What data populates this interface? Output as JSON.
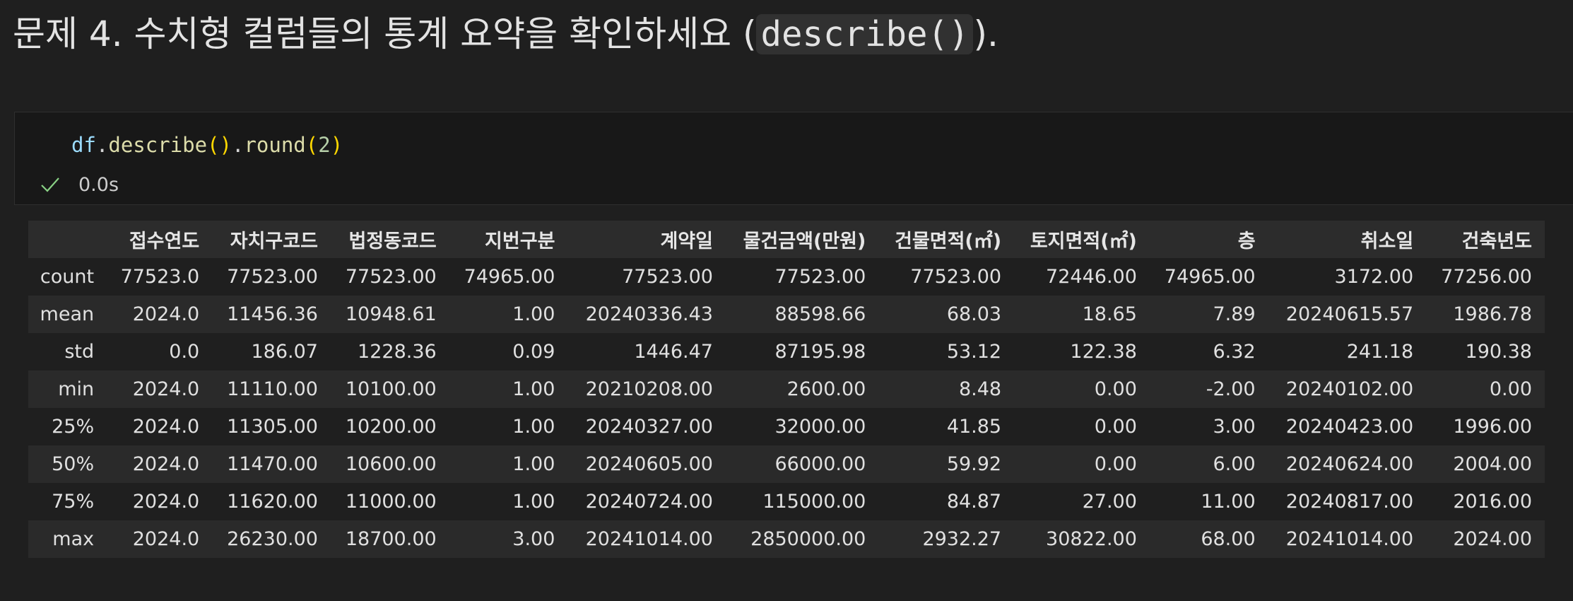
{
  "heading": {
    "prefix": "문제 4. 수치형 컬럼들의 통계 요약을 확인하세요 (",
    "code": "describe()",
    "suffix": ")."
  },
  "cell": {
    "code_tokens": {
      "var": "df",
      "dot1": ".",
      "fn1": "describe",
      "paren1": "()",
      "dot2": ".",
      "fn2": "round",
      "open": "(",
      "arg": "2",
      "close": ")"
    },
    "status_icon": "check-icon",
    "exec_time": "0.0s"
  },
  "table": {
    "columns": [
      "",
      "접수연도",
      "자치구코드",
      "법정동코드",
      "지번구분",
      "계약일",
      "물건금액(만원)",
      "건물면적(㎡)",
      "토지면적(㎡)",
      "층",
      "취소일",
      "건축년도"
    ],
    "rows": [
      {
        "label": "count",
        "values": [
          "77523.0",
          "77523.00",
          "77523.00",
          "74965.00",
          "77523.00",
          "77523.00",
          "77523.00",
          "72446.00",
          "74965.00",
          "3172.00",
          "77256.00"
        ]
      },
      {
        "label": "mean",
        "values": [
          "2024.0",
          "11456.36",
          "10948.61",
          "1.00",
          "20240336.43",
          "88598.66",
          "68.03",
          "18.65",
          "7.89",
          "20240615.57",
          "1986.78"
        ]
      },
      {
        "label": "std",
        "values": [
          "0.0",
          "186.07",
          "1228.36",
          "0.09",
          "1446.47",
          "87195.98",
          "53.12",
          "122.38",
          "6.32",
          "241.18",
          "190.38"
        ]
      },
      {
        "label": "min",
        "values": [
          "2024.0",
          "11110.00",
          "10100.00",
          "1.00",
          "20210208.00",
          "2600.00",
          "8.48",
          "0.00",
          "-2.00",
          "20240102.00",
          "0.00"
        ]
      },
      {
        "label": "25%",
        "values": [
          "2024.0",
          "11305.00",
          "10200.00",
          "1.00",
          "20240327.00",
          "32000.00",
          "41.85",
          "0.00",
          "3.00",
          "20240423.00",
          "1996.00"
        ]
      },
      {
        "label": "50%",
        "values": [
          "2024.0",
          "11470.00",
          "10600.00",
          "1.00",
          "20240605.00",
          "66000.00",
          "59.92",
          "0.00",
          "6.00",
          "20240624.00",
          "2004.00"
        ]
      },
      {
        "label": "75%",
        "values": [
          "2024.0",
          "11620.00",
          "11000.00",
          "1.00",
          "20240724.00",
          "115000.00",
          "84.87",
          "27.00",
          "11.00",
          "20240817.00",
          "2016.00"
        ]
      },
      {
        "label": "max",
        "values": [
          "2024.0",
          "26230.00",
          "18700.00",
          "3.00",
          "20241014.00",
          "2850000.00",
          "2932.27",
          "30822.00",
          "68.00",
          "20241014.00",
          "2024.00"
        ]
      }
    ]
  },
  "colors": {
    "background": "#1f1f1f",
    "check": "#89d185"
  }
}
